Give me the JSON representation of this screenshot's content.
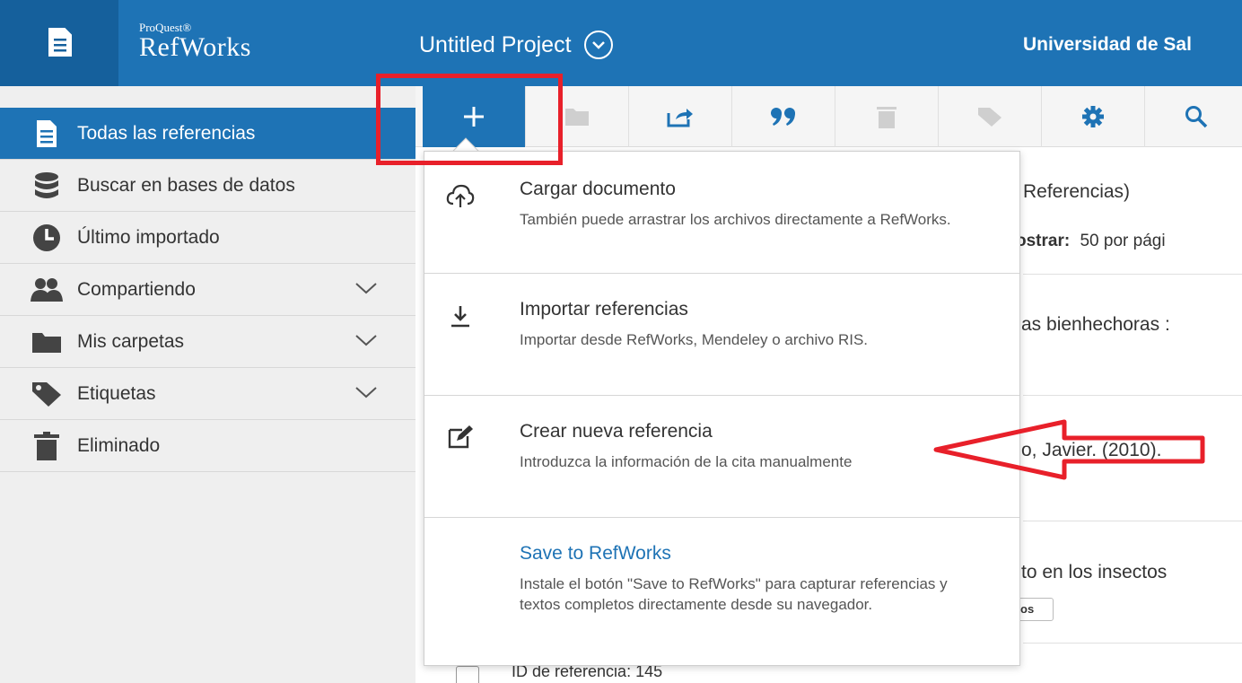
{
  "header": {
    "logo_small": "ProQuest®",
    "logo_big": "RefWorks",
    "project_title": "Untitled Project",
    "university": "Universidad de Sal"
  },
  "sidebar": {
    "items": [
      {
        "label": "Todas las referencias",
        "icon": "document-icon",
        "active": true
      },
      {
        "label": "Buscar en bases de datos",
        "icon": "database-icon"
      },
      {
        "label": "Último importado",
        "icon": "clock-icon"
      },
      {
        "label": "Compartiendo",
        "icon": "people-icon",
        "expandable": true
      },
      {
        "label": "Mis carpetas",
        "icon": "folder-icon",
        "expandable": true
      },
      {
        "label": "Etiquetas",
        "icon": "tag-icon",
        "expandable": true
      },
      {
        "label": "Eliminado",
        "icon": "trash-icon"
      }
    ]
  },
  "toolbar": {
    "buttons": [
      "add-icon",
      "folder-icon",
      "share-icon",
      "quote-icon",
      "trash-icon",
      "tag-icon",
      "gear-icon",
      "search-icon"
    ]
  },
  "background": {
    "count_text": "Referencias)",
    "show_label": "ostrar:",
    "per_page": "50 por pági",
    "row1": "as bienhechoras :",
    "row2": "o, Javier. (2010).",
    "row3": "to en los insectos",
    "tag": "os",
    "ref_id": "ID de referencia: 145"
  },
  "dropdown": {
    "items": [
      {
        "title": "Cargar documento",
        "desc": "También puede arrastrar los archivos directamente a RefWorks.",
        "icon": "cloud-upload-icon"
      },
      {
        "title": "Importar referencias",
        "desc": "Importar desde RefWorks, Mendeley o archivo RIS.",
        "icon": "download-icon"
      },
      {
        "title": "Crear nueva referencia",
        "desc": "Introduzca la información de la cita manualmente",
        "icon": "edit-icon"
      },
      {
        "title": "Save to RefWorks",
        "desc": "Instale el botón \"Save to RefWorks\" para capturar referencias y textos completos directamente desde su navegador."
      }
    ]
  },
  "colors": {
    "brand_blue": "#1e73b5",
    "brand_dark": "#15609c",
    "annotation_red": "#e8202a"
  }
}
